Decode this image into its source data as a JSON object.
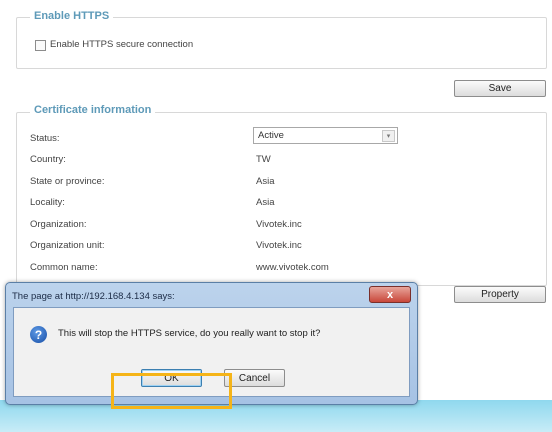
{
  "https_section": {
    "title": "Enable HTTPS",
    "checkbox_label": "Enable HTTPS secure connection"
  },
  "save_button": "Save",
  "cert_section": {
    "title": "Certificate information",
    "rows": [
      {
        "label": "Status:",
        "value": "Active"
      },
      {
        "label": "Country:",
        "value": "TW"
      },
      {
        "label": "State or province:",
        "value": "Asia"
      },
      {
        "label": "Locality:",
        "value": "Asia"
      },
      {
        "label": "Organization:",
        "value": "Vivotek.inc"
      },
      {
        "label": "Organization unit:",
        "value": "Vivotek.inc"
      },
      {
        "label": "Common name:",
        "value": "www.vivotek.com"
      }
    ]
  },
  "property_button": "Property",
  "dialog": {
    "title": "The page at http://192.168.4.134 says:",
    "close_symbol": "x",
    "message": "This will stop the HTTPS service, do you really want to stop it?",
    "ok": "OK",
    "cancel": "Cancel",
    "icon": "question-icon"
  },
  "colors": {
    "legend": "#5e9ab8",
    "highlight": "#f5b418",
    "dialog_frame": "#a6c2e4"
  }
}
